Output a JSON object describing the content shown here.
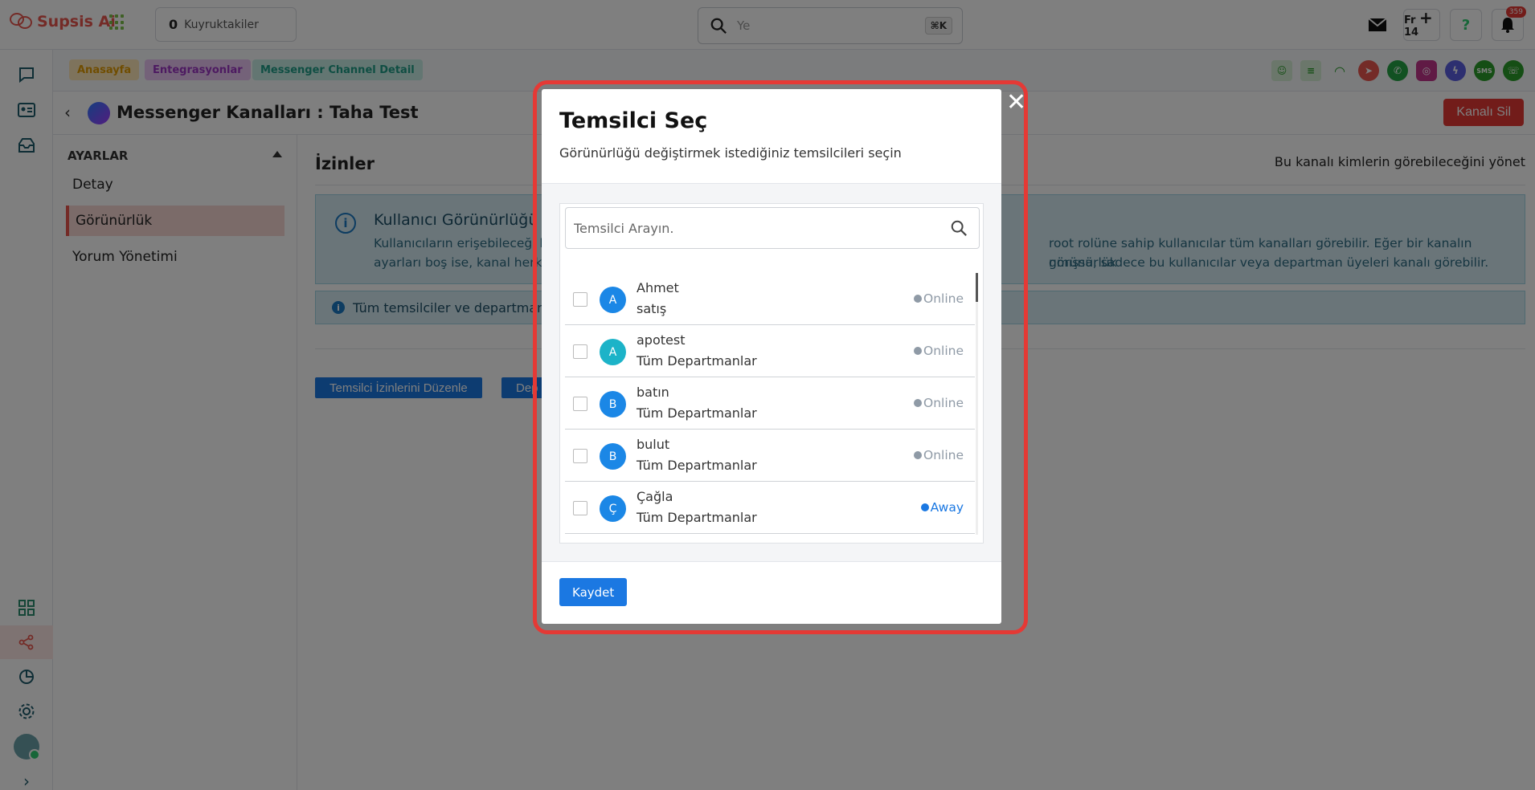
{
  "app": {
    "name": "Supsis Ai"
  },
  "topbar": {
    "queue_count": "0",
    "queue_label": "Kuyruktakiler",
    "search_value": "Ye",
    "search_shortcut": "⌘K",
    "fr_label": "Fr",
    "fr_number": "14",
    "notification_count": "359"
  },
  "breadcrumbs": [
    "Anasayfa",
    "Entegrasyonlar",
    "Messenger Channel Detail"
  ],
  "page": {
    "title": "Messenger Kanalları : Taha Test",
    "delete_button": "Kanalı Sil"
  },
  "settings": {
    "header": "AYARLAR",
    "items": [
      "Detay",
      "Görünürlük",
      "Yorum Yönetimi"
    ],
    "active_index": 1
  },
  "main": {
    "title": "İzinler",
    "description": "Bu kanalı kimlerin görebileceğini yönet",
    "info_title": "Kullanıcı Görünürlüğü",
    "info_text_line1_left": "Kullanıcıların erişebileceği k",
    "info_text_line1_right": "root rolüne sahip kullanıcılar tüm kanalları görebilir. Eğer bir kanalın görünürlük",
    "info_text_line2_left": "ayarları boş ise, kanal herke",
    "info_text_line2_right": "nmışsa, sadece bu kullanıcılar veya departman üyeleri kanalı görebilir.",
    "info2_text": "Tüm temsilciler ve departman c",
    "button_agents": "Temsilci İzinlerini Düzenle",
    "button_dept": "Dep"
  },
  "modal": {
    "title": "Temsilci Seç",
    "subtitle": "Görünürlüğü değiştirmek istediğiniz temsilcileri seçin",
    "search_placeholder": "Temsilci Arayın.",
    "save_button": "Kaydet",
    "agents": [
      {
        "initial": "A",
        "name": "Ahmet",
        "department": "satış",
        "status": "Online",
        "avatar_color": "#1b87e6"
      },
      {
        "initial": "A",
        "name": "apotest",
        "department": "Tüm Departmanlar",
        "status": "Online",
        "avatar_color": "#1cb3c8"
      },
      {
        "initial": "B",
        "name": "batın",
        "department": "Tüm Departmanlar",
        "status": "Online",
        "avatar_color": "#1b87e6"
      },
      {
        "initial": "B",
        "name": "bulut",
        "department": "Tüm Departmanlar",
        "status": "Online",
        "avatar_color": "#1b87e6"
      },
      {
        "initial": "Ç",
        "name": "Çağla",
        "department": "Tüm Departmanlar",
        "status": "Away",
        "avatar_color": "#1b87e6"
      }
    ]
  },
  "colors": {
    "brand": "#e8574f",
    "primary": "#1b78e2",
    "danger": "#e53935"
  }
}
